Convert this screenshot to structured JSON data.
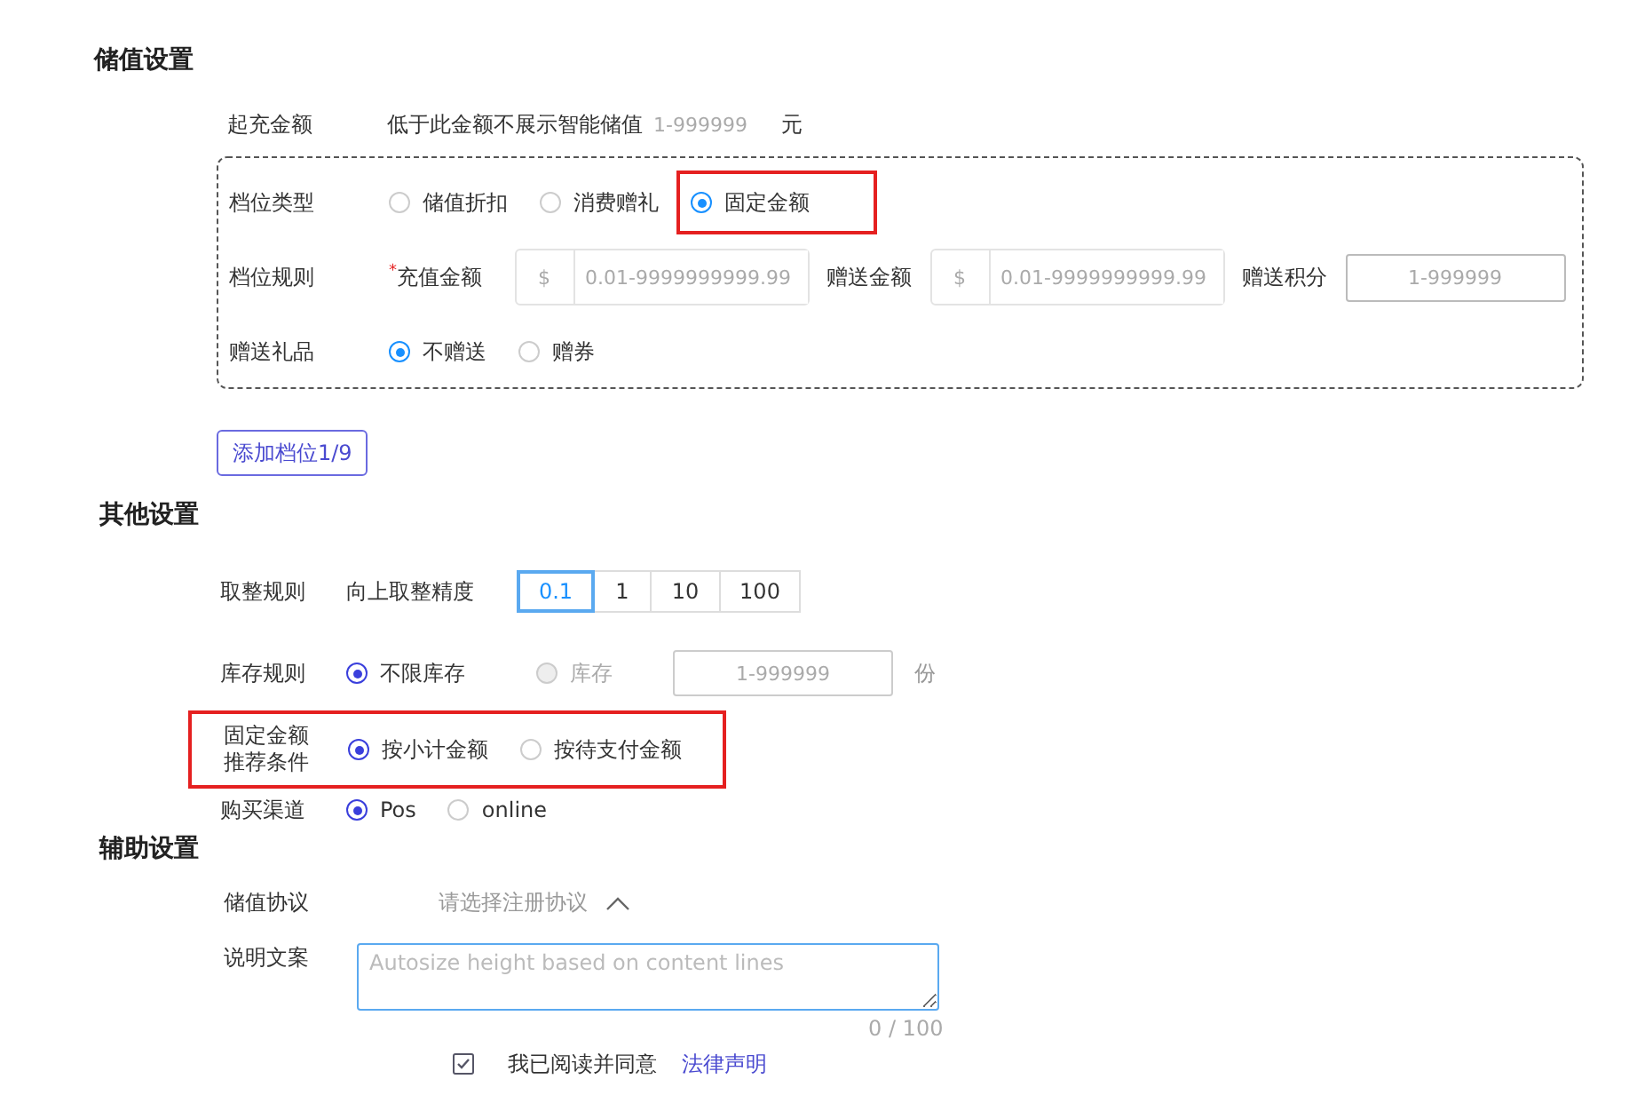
{
  "recharge_settings": {
    "title": "储值设置",
    "min_amount": {
      "label": "起充金额",
      "hint": "低于此金额不展示智能储值",
      "placeholder": "1-999999",
      "unit": "元"
    },
    "tier_type": {
      "label": "档位类型",
      "options": [
        {
          "label": "储值折扣",
          "selected": false,
          "highlighted": false
        },
        {
          "label": "消费赠礼",
          "selected": false,
          "highlighted": false
        },
        {
          "label": "固定金额",
          "selected": true,
          "highlighted": true
        }
      ]
    },
    "tier_rule": {
      "label": "档位规则",
      "fields": [
        {
          "label": "充值金额",
          "required_mark": "*",
          "prefix": "$",
          "placeholder": "0.01-9999999999.99"
        },
        {
          "label": "赠送金额",
          "prefix": "$",
          "placeholder": "0.01-9999999999.99"
        },
        {
          "label": "赠送积分",
          "placeholder": "1-999999"
        }
      ]
    },
    "gift": {
      "label": "赠送礼品",
      "options": [
        {
          "label": "不赠送",
          "selected": true
        },
        {
          "label": "赠券",
          "selected": false
        }
      ]
    },
    "add_button": "添加档位1/9"
  },
  "other_settings": {
    "title": "其他设置",
    "rounding": {
      "label": "取整规则",
      "sublabel": "向上取整精度",
      "options": [
        {
          "label": "0.1",
          "selected": true
        },
        {
          "label": "1",
          "selected": false
        },
        {
          "label": "10",
          "selected": false
        },
        {
          "label": "100",
          "selected": false
        }
      ]
    },
    "stock": {
      "label": "库存规则",
      "options": [
        {
          "label": "不限库存",
          "selected": true,
          "disabled": false
        },
        {
          "label": "库存",
          "selected": false,
          "disabled": true
        }
      ],
      "placeholder": "1-999999",
      "unit": "份"
    },
    "recommend": {
      "label_lines": [
        "固定金额",
        "推荐条件"
      ],
      "highlighted": true,
      "options": [
        {
          "label": "按小计金额",
          "selected": true
        },
        {
          "label": "按待支付金额",
          "selected": false
        }
      ]
    },
    "channel": {
      "label": "购买渠道",
      "options": [
        {
          "label": "Pos",
          "selected": true
        },
        {
          "label": "online",
          "selected": false
        }
      ]
    }
  },
  "aux_settings": {
    "title": "辅助设置",
    "agreement": {
      "label": "储值协议",
      "placeholder": "请选择注册协议",
      "expanded": true
    },
    "description": {
      "label": "说明文案",
      "placeholder": "Autosize height based on content lines",
      "counter": "0 / 100"
    },
    "consent": {
      "checked": true,
      "text": "我已阅读并同意",
      "link": "法律声明"
    }
  }
}
